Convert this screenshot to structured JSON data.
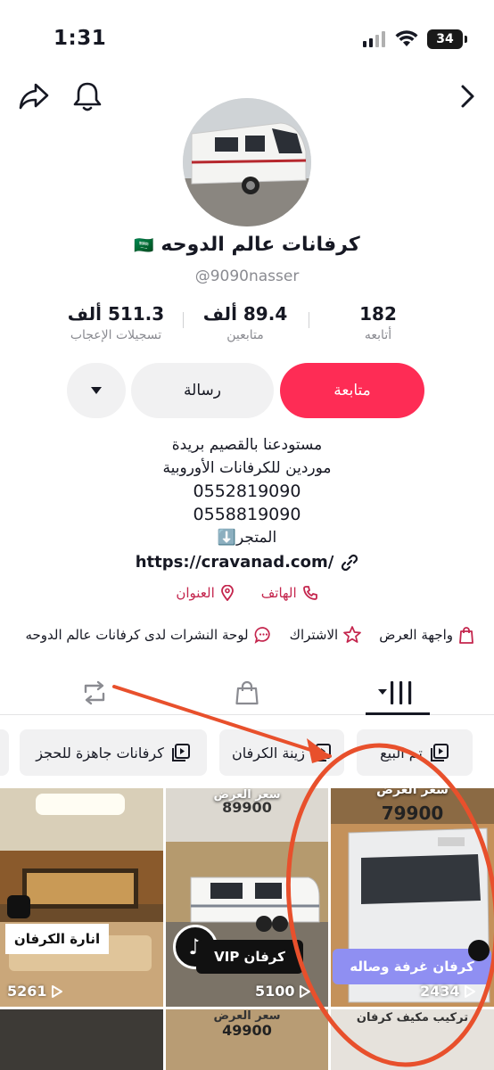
{
  "status": {
    "time": "1:31",
    "battery": "34"
  },
  "profile": {
    "name": "كرفانات عالم الدوحه",
    "flag": "🇸🇦",
    "handle": "@9090nasser"
  },
  "stats": {
    "following": {
      "value": "182",
      "label": "أتابعه"
    },
    "followers": {
      "value": "89.4 ألف",
      "label": "متابعين"
    },
    "likes": {
      "value": "511.3 ألف",
      "label": "تسجيلات الإعجاب"
    }
  },
  "buttons": {
    "follow": "متابعة",
    "message": "رسالة"
  },
  "bio": {
    "line1": "مستودعنا بالقصيم بريدة",
    "line2": "موردين للكرفانات الأوروبية",
    "phone1": "0552819090",
    "phone2": "0558819090",
    "store": "المتجر⬇️",
    "link": "https://cravanad.com/"
  },
  "contacts": {
    "phone": "الهاتف",
    "address": "العنوان"
  },
  "features": {
    "showcase": "واجهة العرض",
    "subscription": "الاشتراك",
    "board": "لوحة النشرات لدى كرفانات عالم الدوحه"
  },
  "chips": {
    "sold": "تم البيع",
    "caravan_decor": "زينة الكرفان",
    "ready": "كرفانات جاهزة للحجز"
  },
  "grid": {
    "cell1": {
      "caption": "انارة الكرفان",
      "views": "5261"
    },
    "cell2": {
      "price_label": "سعر العرض",
      "price": "89900",
      "badge": "كرفان VIP",
      "views": "5100"
    },
    "cell3": {
      "price_label": "سعر العرض",
      "price": "79900",
      "badge": "كرفان غرفة وصاله",
      "views": "2434"
    },
    "cell4": {
      "price_label": "سعر العرض",
      "price": "49900"
    },
    "cell5": {
      "caption": "تركيب مكيف كرفان"
    }
  },
  "colors": {
    "accent": "#fe2c55",
    "annotation": "#e8502c",
    "contact": "#c4254d"
  }
}
